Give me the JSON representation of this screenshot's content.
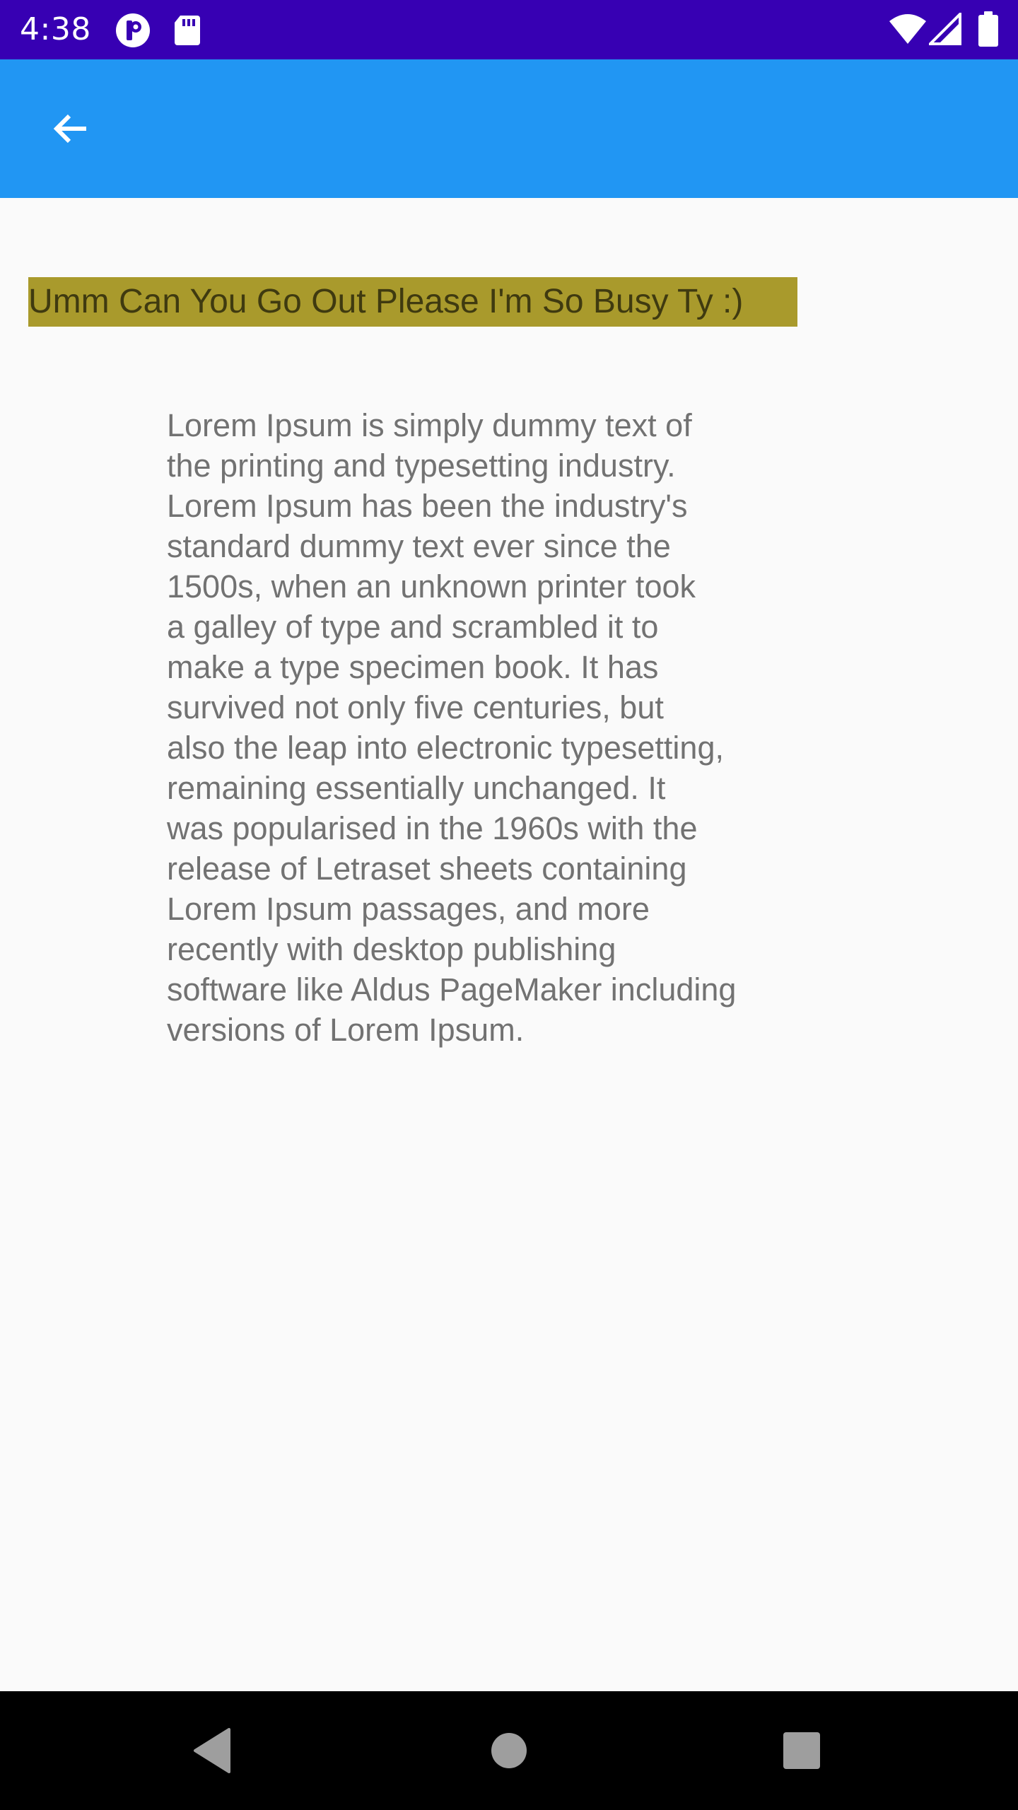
{
  "status_bar": {
    "time": "4:38",
    "icons": [
      "notification-p-icon",
      "sd-card-icon",
      "wifi-icon",
      "signal-icon",
      "battery-icon"
    ]
  },
  "app_bar": {
    "back_icon": "arrow-back-icon",
    "color": "#2196f3"
  },
  "content": {
    "banner_text": "Umm Can You Go Out Please I'm So Busy Ty :)",
    "banner_color": "#a99a2c",
    "body_lines": [
      "Lorem Ipsum is simply dummy text of",
      "the printing and typesetting industry.",
      "Lorem Ipsum has been the industry's",
      "standard dummy text ever since the",
      "1500s, when an unknown printer took",
      "a galley of type and scrambled it to",
      "make a type specimen book. It has",
      "survived not only five centuries, but",
      "also the leap into electronic typesetting,",
      "remaining essentially unchanged. It",
      "was popularised in the 1960s with the",
      "release of Letraset sheets containing",
      "Lorem Ipsum passages, and more",
      "recently with desktop publishing",
      "software like Aldus PageMaker including",
      "versions of Lorem Ipsum."
    ]
  },
  "nav_bar": {
    "buttons": [
      "back-triangle-icon",
      "home-circle-icon",
      "recents-square-icon"
    ]
  }
}
